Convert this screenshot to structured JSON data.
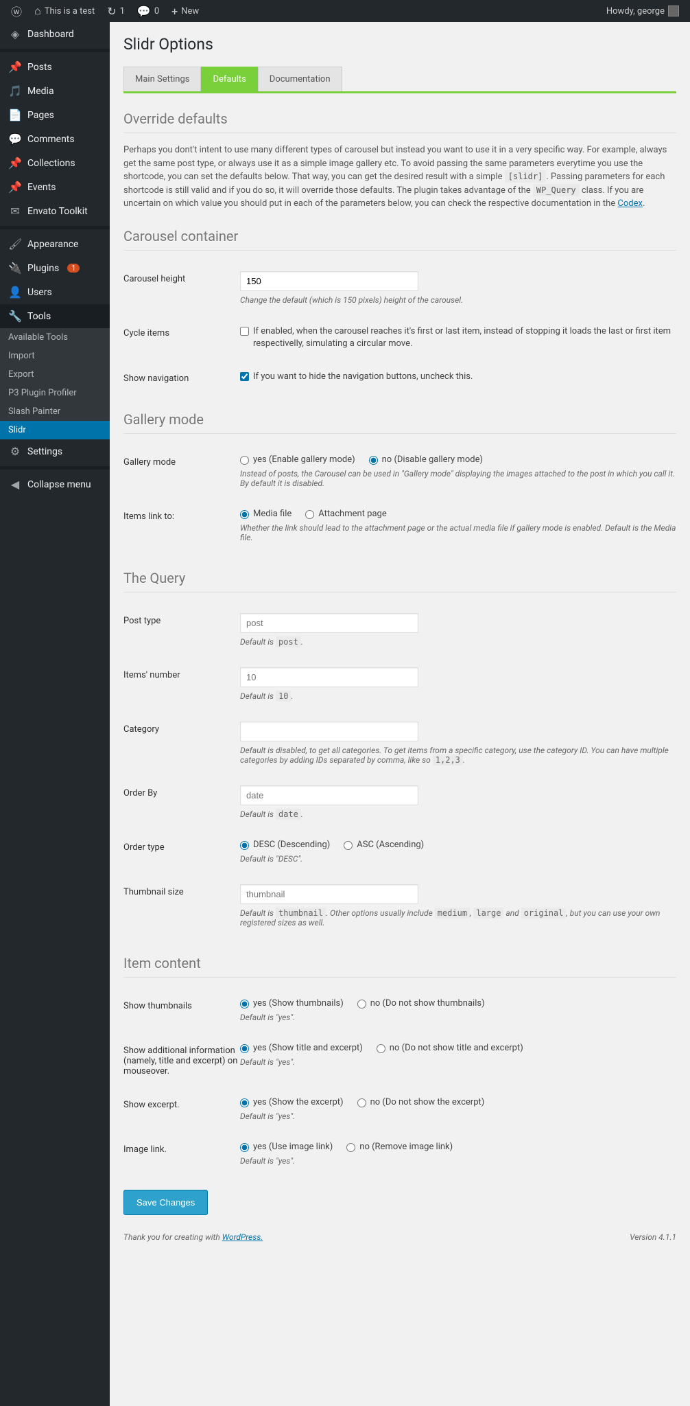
{
  "adminbar": {
    "site_name": "This is a test",
    "updates": "1",
    "comments": "0",
    "new": "New",
    "howdy": "Howdy, george"
  },
  "sidebar": {
    "items": [
      {
        "icon": "⏲",
        "label": "Dashboard"
      },
      {
        "icon": "📌",
        "label": "Posts"
      },
      {
        "icon": "🎵",
        "label": "Media"
      },
      {
        "icon": "📄",
        "label": "Pages"
      },
      {
        "icon": "💬",
        "label": "Comments"
      },
      {
        "icon": "📌",
        "label": "Collections"
      },
      {
        "icon": "📌",
        "label": "Events"
      },
      {
        "icon": "✉",
        "label": "Envato Toolkit"
      }
    ],
    "items2": [
      {
        "icon": "🖌",
        "label": "Appearance"
      },
      {
        "icon": "🔌",
        "label": "Plugins",
        "badge": "1"
      },
      {
        "icon": "👤",
        "label": "Users"
      },
      {
        "icon": "🔧",
        "label": "Tools",
        "open": true
      }
    ],
    "submenu": [
      {
        "label": "Available Tools"
      },
      {
        "label": "Import"
      },
      {
        "label": "Export"
      },
      {
        "label": "P3 Plugin Profiler"
      },
      {
        "label": "Slash Painter"
      },
      {
        "label": "Slidr",
        "current": true
      }
    ],
    "items3": [
      {
        "icon": "⚙",
        "label": "Settings"
      }
    ],
    "collapse": {
      "icon": "◀",
      "label": "Collapse menu"
    }
  },
  "page": {
    "title": "Slidr Options",
    "tabs": [
      {
        "label": "Main Settings"
      },
      {
        "label": "Defaults",
        "active": true
      },
      {
        "label": "Documentation"
      }
    ],
    "override": {
      "title": "Override defaults",
      "text1": "Perhaps you dont't intent to use many different types of carousel but instead you want to use it in a very specific way. For example, always get the same post type, or always use it as a simple image gallery etc. To avoid passing the same parameters everytime you use the shortcode, you can set the defaults below. That way, you can get the desired result with a simple ",
      "code1": "[slidr]",
      "text2": ". Passing parameters for each shortcode is still valid and if you do so, it will override those defaults. The plugin takes advantage of the ",
      "code2": "WP_Query",
      "text3": " class. If you are uncertain on which value you should put in each of the parameters below, you can check the respective documentation in the ",
      "link": "Codex",
      "text4": "."
    },
    "carousel": {
      "title": "Carousel container",
      "height_label": "Carousel height",
      "height_value": "150",
      "height_desc": "Change the default (which is 150 pixels) height of the carousel.",
      "cycle_label": "Cycle items",
      "cycle_desc": "If enabled, when the carousel reaches it's first or last item, instead of stopping it loads the last or first item respectivelly, simulating a circular move.",
      "nav_label": "Show navigation",
      "nav_desc": "If you want to hide the navigation buttons, uncheck this."
    },
    "gallery": {
      "title": "Gallery mode",
      "mode_label": "Gallery mode",
      "mode_yes": "yes (Enable gallery mode)",
      "mode_no": "no (Disable gallery mode)",
      "mode_desc": "Instead of posts, the Carousel can be used in \"Gallery mode\" displaying the images attached to the post in which you call it. By default it is disabled.",
      "link_label": "Items link to:",
      "link_media": "Media file",
      "link_attach": "Attachment page",
      "link_desc": "Whether the link should lead to the attachment page or the actual media file if gallery mode is enabled. Default is the Media file."
    },
    "query": {
      "title": "The Query",
      "posttype_label": "Post type",
      "posttype_ph": "post",
      "posttype_desc_pre": "Default is ",
      "posttype_desc_code": "post",
      "itemsnum_label": "Items' number",
      "itemsnum_ph": "10",
      "itemsnum_desc_pre": "Default is ",
      "itemsnum_desc_code": "10",
      "cat_label": "Category",
      "cat_desc_pre": "Default is disabled, to get all categories. To get items from a specific category, use the category ID. You can have multiple categories by adding IDs separated by comma, like so ",
      "cat_desc_code": "1,2,3",
      "orderby_label": "Order By",
      "orderby_ph": "date",
      "orderby_desc_pre": "Default is ",
      "orderby_desc_code": "date",
      "ordertype_label": "Order type",
      "ordertype_desc": "DESC (Descending)",
      "ordertype_asc": "ASC (Ascending)",
      "ordertype_desc_text": "Default is \"DESC\".",
      "thumb_label": "Thumbnail size",
      "thumb_ph": "thumbnail",
      "thumb_desc1": "Default is ",
      "thumb_code1": "thumbnail",
      "thumb_desc2": ". Other options usually include ",
      "thumb_code2": "medium",
      "thumb_desc3": ", ",
      "thumb_code3": "large",
      "thumb_desc4": " and ",
      "thumb_code4": "original",
      "thumb_desc5": ", but you can use your own registered sizes as well."
    },
    "itemcontent": {
      "title": "Item content",
      "thumbs_label": "Show thumbnails",
      "thumbs_yes": "yes (Show thumbnails)",
      "thumbs_no": "no (Do not show thumbnails)",
      "thumbs_desc": "Default is \"yes\".",
      "addl_label": "Show additional information (namely, title and excerpt) on mouseover.",
      "addl_yes": "yes (Show title and excerpt)",
      "addl_no": "no (Do not show title and excerpt)",
      "addl_desc": "Default is \"yes\".",
      "excerpt_label": "Show excerpt.",
      "excerpt_yes": "yes (Show the excerpt)",
      "excerpt_no": "no (Do not show the excerpt)",
      "excerpt_desc": "Default is \"yes\".",
      "imglink_label": "Image link.",
      "imglink_yes": "yes (Use image link)",
      "imglink_no": "no (Remove image link)",
      "imglink_desc": "Default is \"yes\"."
    },
    "save": "Save Changes",
    "footer": {
      "thanks_pre": "Thank you for creating with ",
      "thanks_link": "WordPress.",
      "version": "Version 4.1.1"
    }
  }
}
